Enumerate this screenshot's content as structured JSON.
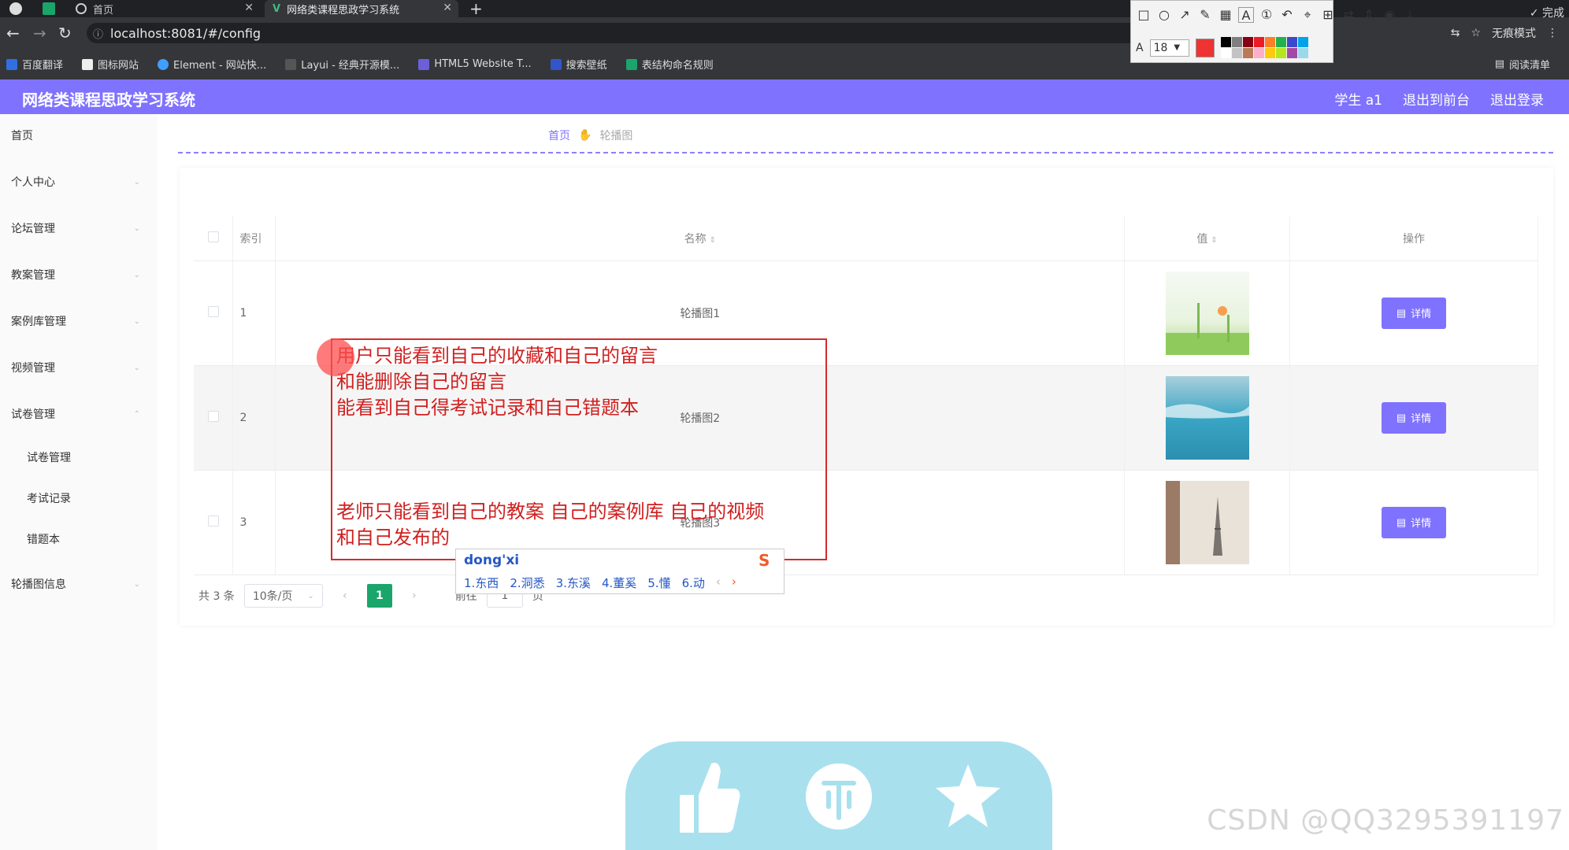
{
  "browser": {
    "tabs": [
      {
        "label": "首页"
      },
      {
        "label": "网络类课程思政学习系统"
      }
    ],
    "url": "localhost:8081/#/config",
    "bookmarks": [
      "百度翻译",
      "图标网站",
      "Element - 网站快...",
      "Layui - 经典开源模...",
      "HTML5 Website T...",
      "搜索壁纸",
      "表结构命名规则"
    ],
    "incognito_label": "无痕模式",
    "reading_list_label": "阅读清单"
  },
  "snip_tool": {
    "font_label": "A",
    "font_size": "18",
    "finish_label": "完成",
    "current_color": "#ee3333",
    "palette": [
      "#000000",
      "#7f7f7f",
      "#880015",
      "#ed1c24",
      "#ff7f27",
      "#22b14c",
      "#3f48cc",
      "#00a2e8",
      "#ffffff",
      "#c3c3c3",
      "#b97a57",
      "#ffaec9",
      "#ffc90e",
      "#b5e61d",
      "#a349a4",
      "#99d9ea"
    ]
  },
  "app": {
    "title": "网络类课程思政学习系统",
    "header_links": [
      "学生 a1",
      "退出到前台",
      "退出登录"
    ]
  },
  "sidebar": {
    "items": [
      {
        "label": "首页"
      },
      {
        "label": "个人中心"
      },
      {
        "label": "论坛管理"
      },
      {
        "label": "教案管理"
      },
      {
        "label": "案例库管理"
      },
      {
        "label": "视频管理"
      },
      {
        "label": "试卷管理"
      },
      {
        "label": "试卷管理"
      },
      {
        "label": "考试记录"
      },
      {
        "label": "错题本"
      },
      {
        "label": "轮播图信息"
      }
    ]
  },
  "breadcrumb": {
    "home": "首页",
    "current": "轮播图"
  },
  "table": {
    "headers": {
      "index": "索引",
      "name": "名称",
      "value": "值",
      "action": "操作"
    },
    "rows": [
      {
        "index": "1",
        "name": "轮播图1",
        "action": "详情"
      },
      {
        "index": "2",
        "name": "轮播图2",
        "action": "详情"
      },
      {
        "index": "3",
        "name": "轮播图3",
        "action": "详情"
      }
    ]
  },
  "pagination": {
    "total": "共 3 条",
    "page_size": "10条/页",
    "current": "1",
    "goto_prefix": "前往",
    "goto_value": "1",
    "goto_suffix": "页"
  },
  "annotation": {
    "line1": "用户只能看到自己的收藏和自己的留言",
    "line2": "和能删除自己的留言",
    "line3": "能看到自己得考试记录和自己错题本",
    "line4": "老师只能看到自己的教案 自己的案例库 自己的视频",
    "line5": "和自己发布的"
  },
  "ime": {
    "pinyin": "dong'xi",
    "candidates": [
      "1.东西",
      "2.洞悉",
      "3.东溪",
      "4.董奚",
      "5.懂",
      "6.动"
    ]
  },
  "watermark": "CSDN @QQ3295391197",
  "colors": {
    "accent": "#7f72ff",
    "annotation": "#d32c2c",
    "pager_active": "#1aa56b"
  }
}
